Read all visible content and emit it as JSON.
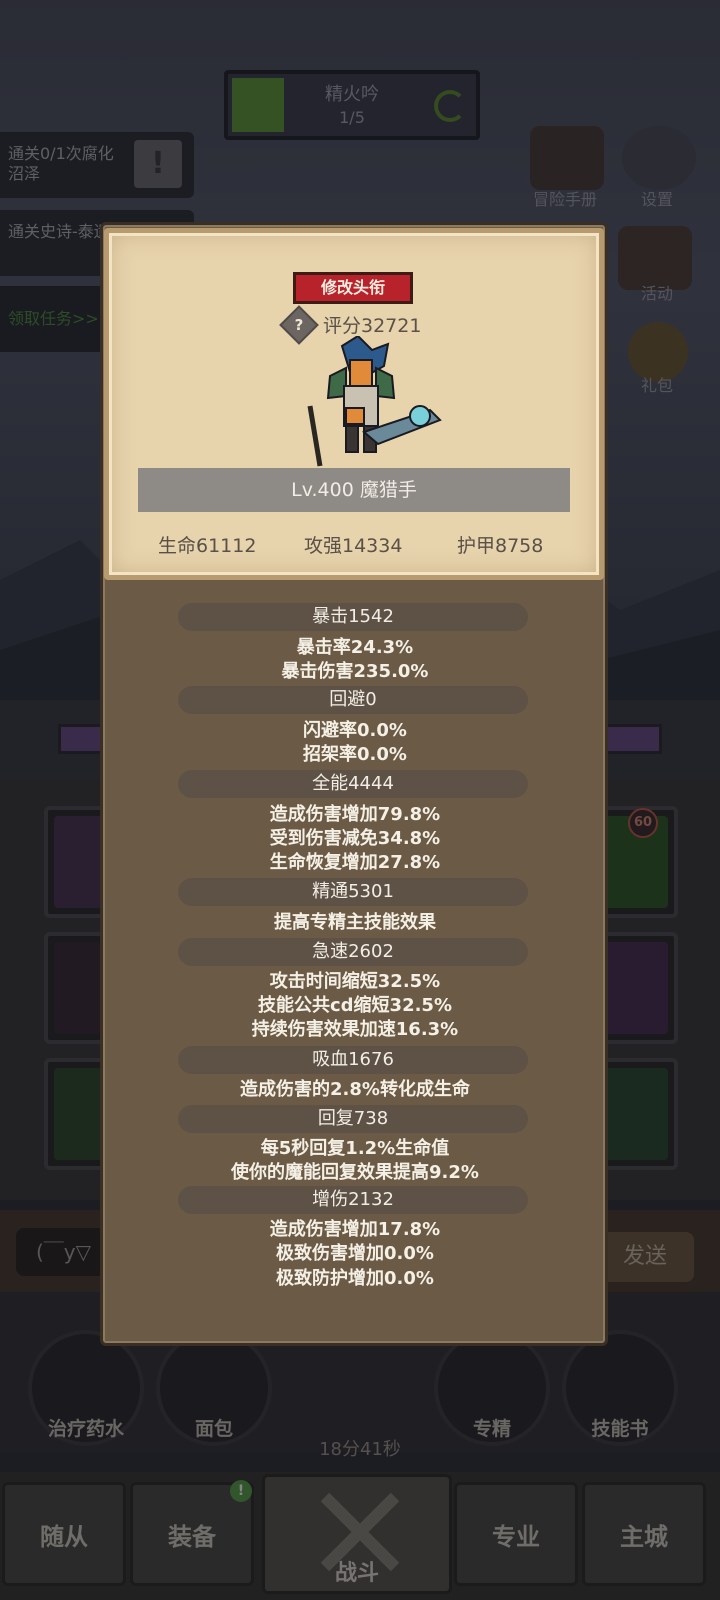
{
  "background": {
    "top_bar": {
      "title": "精火吟",
      "progress": "1/5"
    },
    "quests": [
      {
        "text": "通关0/1次腐化沼泽"
      },
      {
        "text": "通关史诗-泰遗迹"
      }
    ],
    "claim_task": "领取任务>>",
    "side_menu": [
      {
        "label": "冒险手册"
      },
      {
        "label": "设置"
      },
      {
        "label": "活动"
      },
      {
        "label": "礼包"
      }
    ],
    "chat": {
      "placeholder": "(￣y▽",
      "send": "发送"
    },
    "quick_items": [
      {
        "label": "治疗药水"
      },
      {
        "label": "面包"
      },
      {
        "label": "专精"
      },
      {
        "label": "技能书"
      }
    ],
    "timer": "18分41秒",
    "bottom_nav": [
      {
        "label": "随从"
      },
      {
        "label": "装备"
      },
      {
        "label": "战斗"
      },
      {
        "label": "专业"
      },
      {
        "label": "主城"
      }
    ],
    "equip_badge": "!",
    "slot_badge": "60"
  },
  "panel": {
    "title_button": "修改头衔",
    "help": "?",
    "score": "评分32721",
    "level": "Lv.400 魔猎手",
    "stats": {
      "hp": "生命61112",
      "atk": "攻强14334",
      "armor": "护甲8758"
    },
    "sections": [
      {
        "header": "暴击1542",
        "lines": [
          "暴击率24.3%",
          "暴击伤害235.0%"
        ]
      },
      {
        "header": "回避0",
        "lines": [
          "闪避率0.0%",
          "招架率0.0%"
        ]
      },
      {
        "header": "全能4444",
        "lines": [
          "造成伤害增加79.8%",
          "受到伤害减免34.8%",
          "生命恢复增加27.8%"
        ]
      },
      {
        "header": "精通5301",
        "lines": [
          "提高专精主技能效果"
        ]
      },
      {
        "header": "急速2602",
        "lines": [
          "攻击时间缩短32.5%",
          "技能公共cd缩短32.5%",
          "持续伤害效果加速16.3%"
        ]
      },
      {
        "header": "吸血1676",
        "lines": [
          "造成伤害的2.8%转化成生命"
        ]
      },
      {
        "header": "回复738",
        "lines": [
          "每5秒回复1.2%生命值",
          "使你的魔能回复效果提高9.2%"
        ]
      },
      {
        "header": "增伤2132",
        "lines": [
          "造成伤害增加17.8%",
          "极致伤害增加0.0%",
          "极致防护增加0.0%"
        ]
      }
    ]
  }
}
